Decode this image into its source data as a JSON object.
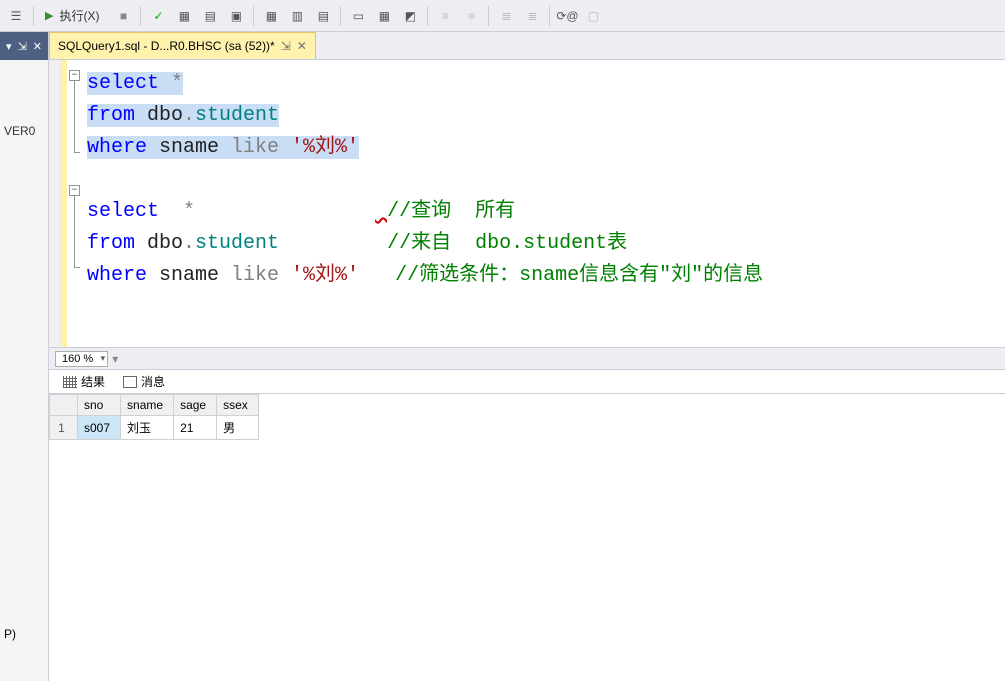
{
  "toolbar": {
    "execute_label": "执行(X)"
  },
  "sidebar": {
    "pin_icon": "⇲",
    "close_icon": "✕",
    "obj_explorer_item": "VER0",
    "bottom_item": "P)"
  },
  "tab": {
    "title": "SQLQuery1.sql - D...R0.BHSC (sa (52))*",
    "pin": "⇲",
    "close": "✕"
  },
  "code": {
    "b1": {
      "select": "select",
      "star": " *",
      "from": "from",
      "dbo": " dbo",
      "dot": ".",
      "student": "student",
      "where": "where",
      "sname": " sname ",
      "like": "like",
      "str": " '%刘%'"
    },
    "b2": {
      "select": "select",
      "star_pre": "  ",
      "star": "*",
      "c1": "//查询  所有",
      "from": "from",
      "dbo": " dbo",
      "dot": ".",
      "student": "student",
      "c2": "//来自  dbo.student表",
      "where": "where",
      "sname": " sname ",
      "like": "like",
      "str": " '%刘%'",
      "c3": "//筛选条件：sname信息含有\"刘\"的信息"
    }
  },
  "zoom": {
    "value": "160 %"
  },
  "results_tabs": {
    "results": "结果",
    "messages": "消息"
  },
  "grid": {
    "headers": [
      "",
      "sno",
      "sname",
      "sage",
      "ssex"
    ],
    "rows": [
      {
        "num": "1",
        "cells": [
          "s007",
          "刘玉",
          "21",
          "男"
        ]
      }
    ]
  }
}
